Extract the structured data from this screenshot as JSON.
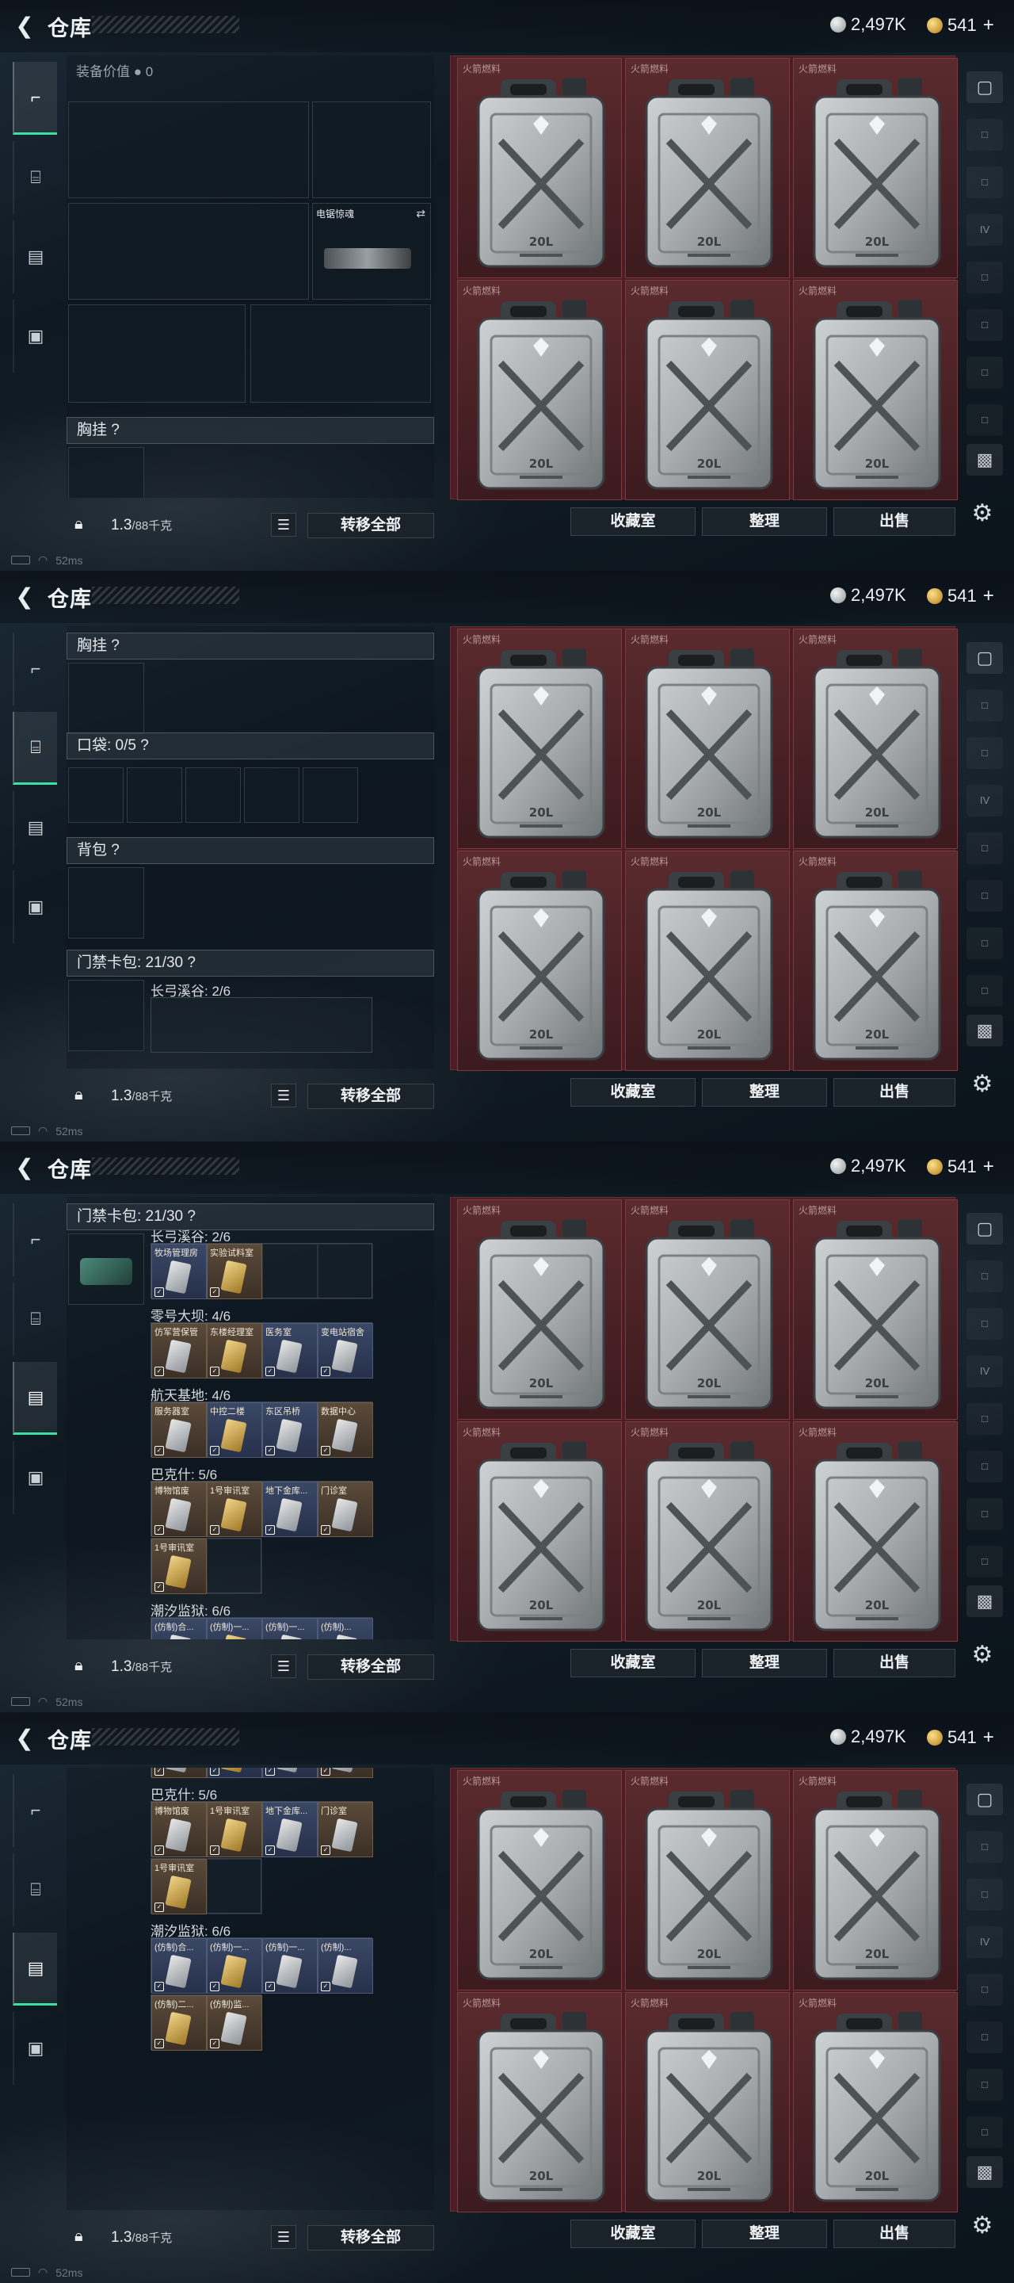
{
  "app": {
    "title": "仓库"
  },
  "currency": {
    "silver": "2,497K",
    "gold": "541",
    "plus": "+"
  },
  "status": {
    "ping": "52ms"
  },
  "weight": {
    "current": "1.3",
    "max": "/88千克"
  },
  "buttons": {
    "transfer_all": "转移全部",
    "collection": "收藏室",
    "sort": "整理",
    "sell": "出售"
  },
  "equipment": {
    "value_label": "装备价值",
    "value": "0",
    "melee_name": "电锯惊魂",
    "chest_rig": "胸挂 ?",
    "pockets": "口袋: 0/5 ?",
    "backpack": "背包 ?",
    "keycard_case": "门禁卡包: 21/30 ?"
  },
  "stash": {
    "item_label": "火箭燃料",
    "jerrycan_text": "20L"
  },
  "right_strip": {
    "tabs": [
      "IV"
    ]
  },
  "keycards": [
    {
      "map": "长弓溪谷: 2/6",
      "cards": [
        {
          "name": "牧场管理房",
          "tone": "blue"
        },
        {
          "name": "实验试料室",
          "tone": "brown"
        }
      ]
    },
    {
      "map": "零号大坝: 4/6",
      "cards": [
        {
          "name": "仿军营保管",
          "tone": "brown"
        },
        {
          "name": "东楼经理室",
          "tone": "brown"
        },
        {
          "name": "医务室",
          "tone": "blue"
        },
        {
          "name": "变电站宿舍",
          "tone": "blue"
        }
      ]
    },
    {
      "map": "航天基地: 4/6",
      "cards": [
        {
          "name": "服务器室",
          "tone": "brown"
        },
        {
          "name": "中控二楼",
          "tone": "blue"
        },
        {
          "name": "东区吊桥",
          "tone": "blue"
        },
        {
          "name": "数据中心",
          "tone": "brown"
        }
      ]
    },
    {
      "map": "巴克什: 5/6",
      "cards": [
        {
          "name": "博物馆废",
          "tone": "brown"
        },
        {
          "name": "1号审讯室",
          "tone": "brown"
        },
        {
          "name": "地下金库...",
          "tone": "blue"
        },
        {
          "name": "门诊室",
          "tone": "brown"
        },
        {
          "name": "1号审讯室",
          "tone": "brown"
        }
      ]
    },
    {
      "map": "潮汐监狱: 6/6",
      "cards": [
        {
          "name": "(仿制)合...",
          "tone": "blue"
        },
        {
          "name": "(仿制)一...",
          "tone": "blue"
        },
        {
          "name": "(仿制)一...",
          "tone": "blue"
        },
        {
          "name": "(仿制)...",
          "tone": "blue"
        },
        {
          "name": "(仿制)二...",
          "tone": "brown"
        },
        {
          "name": "(仿制)监...",
          "tone": "brown"
        }
      ]
    }
  ]
}
